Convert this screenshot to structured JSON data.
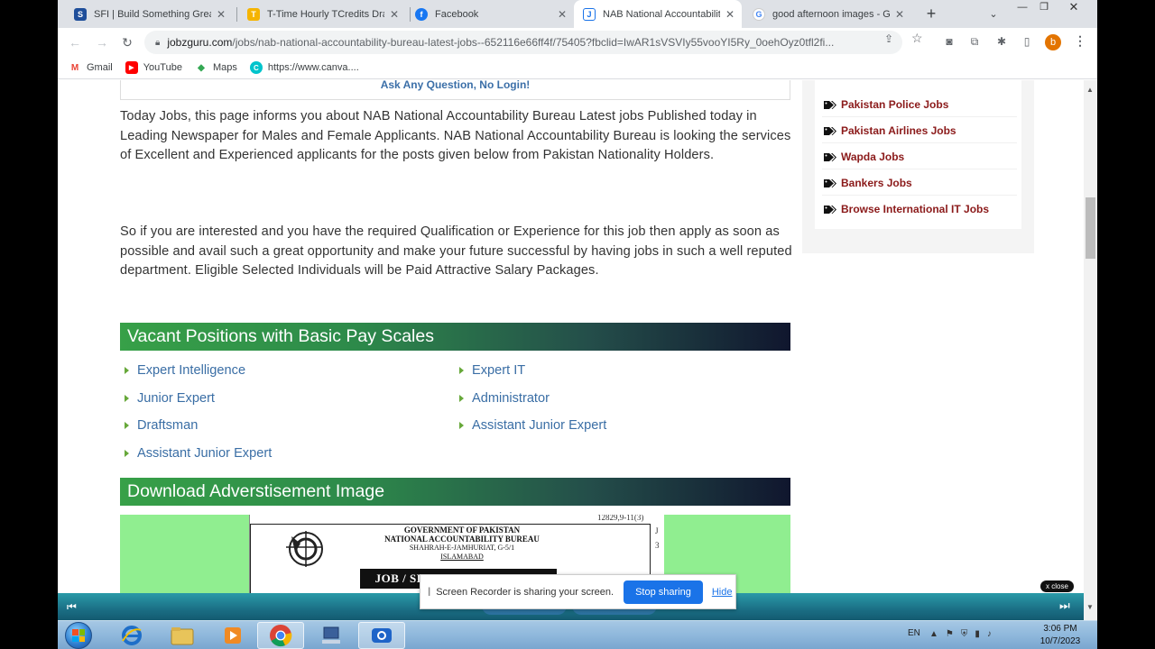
{
  "browser": {
    "tabs": [
      {
        "label": "SFI | Build Something Great",
        "icon_color": "#1f4e9a",
        "icon_letter": "S"
      },
      {
        "label": "T-Time Hourly TCredits Draw",
        "icon_color": "#f5b400",
        "icon_letter": "T"
      },
      {
        "label": "Facebook",
        "icon_color": "#1877f2",
        "icon_letter": "f"
      },
      {
        "label": "NAB National Accountability",
        "icon_color": "#1a73e8",
        "icon_letter": "J"
      },
      {
        "label": "good afternoon images - G",
        "icon_color": "#4285f4",
        "icon_letter": "G"
      }
    ],
    "new_tab": "+",
    "url_domain": "jobzguru.com",
    "url_path": "/jobs/nab-national-accountability-bureau-latest-jobs--652116e66ff4f/75405?fbclid=IwAR1sVSVIy55vooYI5Ry_0oehOyz0tfl2fi...",
    "bookmarks": [
      {
        "label": "Gmail",
        "icon": "gmail-icon",
        "color": "#ea4335"
      },
      {
        "label": "YouTube",
        "icon": "youtube-icon",
        "color": "#ff0000"
      },
      {
        "label": "Maps",
        "icon": "maps-icon",
        "color": "#34a853"
      },
      {
        "label": "https://www.canva....",
        "icon": "canva-icon",
        "color": "#00c4cc"
      }
    ],
    "profile_letter": "b"
  },
  "page": {
    "top_box_text": "Ask Any Question, No Login!",
    "paragraph1": "Today Jobs, this page informs you about NAB National Accountability Bureau Latest jobs Published today in Leading Newspaper for Males and Female Applicants. NAB National Accountability Bureau is looking the services of Excellent and Experienced applicants for the posts given below from Pakistan Nationality Holders.",
    "paragraph2": "So if you are interested and you have the required Qualification or Experience for this job then apply as soon as possible and avail such a great opportunity and make your future successful by having jobs in such a well reputed department. Eligible Selected Individuals will be Paid Attractive Salary Packages.",
    "vacant_heading": "Vacant Positions with Basic Pay Scales",
    "positions": [
      "Expert Intelligence",
      "Expert IT",
      "Junior Expert",
      "Administrator",
      "Draftsman",
      "Assistant Junior Expert",
      "Assistant Junior Expert"
    ],
    "download_heading": "Download Adverstisement Image",
    "ad": {
      "top_num": "12829,9-11(3)",
      "line1": "GOVERNMENT OF PAKISTAN",
      "line2": "NATIONAL ACCOUNTABILITY BUREAU",
      "line3": "SHAHRAH-E-JAMHURIAT, G-5/1",
      "line4": "ISLAMABAD",
      "banner": "JOB / SERVICES REQUIRED",
      "side1": "J",
      "side2": "3"
    },
    "sidebar_links": [
      "Pakistan Police Jobs",
      "Pakistan Airlines Jobs",
      "Wapda Jobs",
      "Bankers Jobs",
      "Browse International IT Jobs"
    ],
    "sidebar_link_color": "#8b1a1a",
    "accent_green": "#37a048",
    "position_link_color": "#3a6ea5"
  },
  "recorder": {
    "notice_text": "Screen Recorder is sharing your screen.",
    "stop_label": "Stop sharing",
    "hide_label": "Hide",
    "close_label": "x close",
    "bar_color": "#1b6f85"
  },
  "taskbar": {
    "language": "EN",
    "time": "3:06 PM",
    "date": "10/7/2023"
  }
}
